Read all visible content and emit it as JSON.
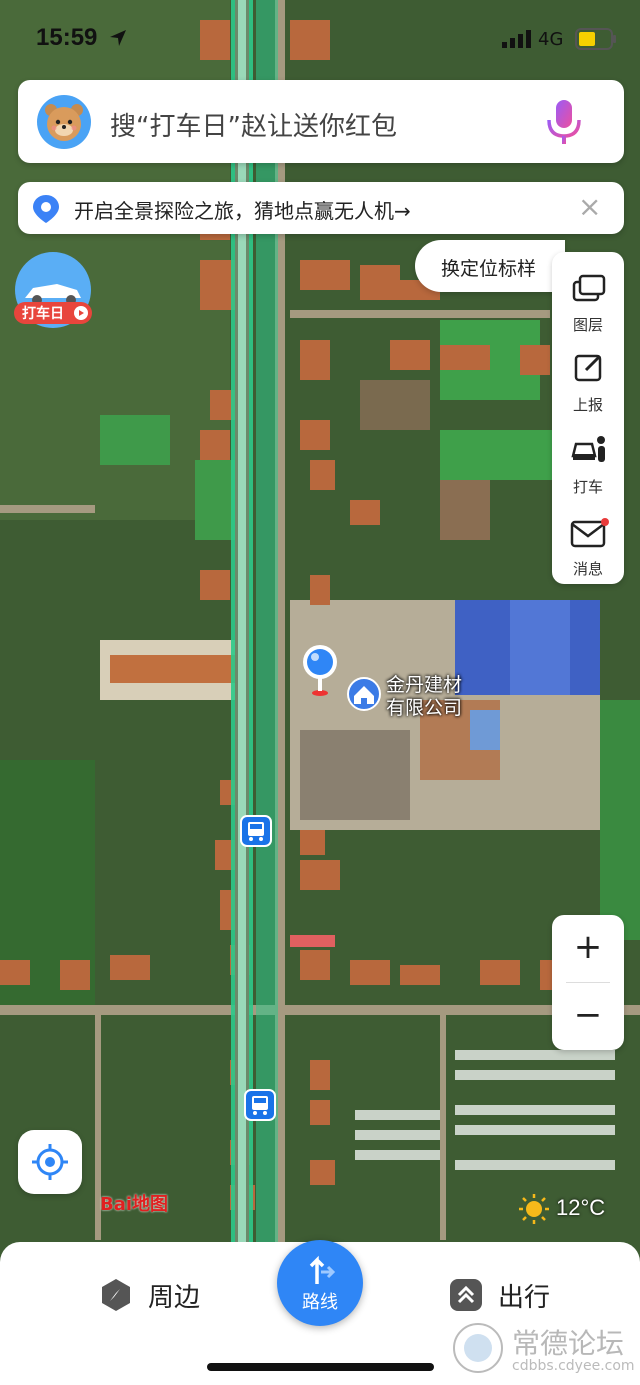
{
  "status": {
    "time": "15:59",
    "network": "4G",
    "battery_color": "#f5d000"
  },
  "search": {
    "placeholder": "搜“打车日”赵让送你红包",
    "mic_icon": "mic-icon",
    "avatar_icon": "bear-avatar-icon"
  },
  "banner": {
    "text": "开启全景探险之旅，猜地点赢无人机→",
    "close": "×"
  },
  "promo": {
    "label": "打车日"
  },
  "tip": {
    "text": "换定位标样"
  },
  "tools": [
    {
      "label": "图层",
      "icon": "layers-icon"
    },
    {
      "label": "上报",
      "icon": "report-icon"
    },
    {
      "label": "打车",
      "icon": "taxi-icon"
    },
    {
      "label": "消息",
      "icon": "mail-icon",
      "badge": true
    }
  ],
  "poi": {
    "line1": "金丹建材",
    "line2": "有限公司"
  },
  "zoom": {
    "plus": "+",
    "minus": "−"
  },
  "logo": "Bai地图",
  "weather": {
    "temp": "12°C"
  },
  "bottom": {
    "nearby": "周边",
    "route": "路线",
    "travel": "出行"
  },
  "watermark": {
    "title": "常德论坛",
    "url": "cdbbs.cdyee.com"
  },
  "colors": {
    "accent": "#2f86f6",
    "road": "#2ec98a"
  }
}
